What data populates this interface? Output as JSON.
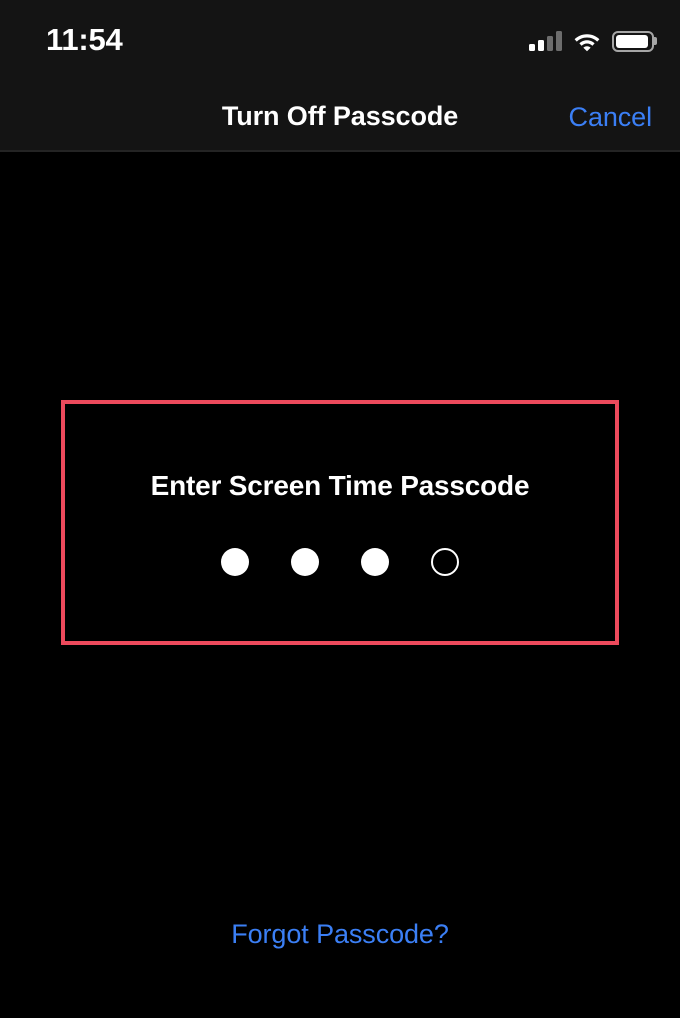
{
  "status_bar": {
    "time": "11:54",
    "cellular_icon": "cellular-signal-icon",
    "cellular_bars_total": 4,
    "cellular_bars_active": 2,
    "wifi_icon": "wifi-icon",
    "battery_icon": "battery-icon",
    "battery_percent": 95
  },
  "nav_bar": {
    "title": "Turn Off Passcode",
    "cancel_label": "Cancel"
  },
  "content": {
    "prompt": "Enter Screen Time Passcode",
    "passcode_length": 4,
    "passcode_entered": 3,
    "forgot_label": "Forgot Passcode?"
  },
  "annotation": {
    "type": "highlight-rectangle",
    "color": "#ed4a5c"
  },
  "colors": {
    "background": "#000000",
    "header_background": "#141414",
    "accent_blue": "#3b7ff5",
    "highlight_red": "#ed4a5c",
    "text_primary": "#ffffff"
  }
}
